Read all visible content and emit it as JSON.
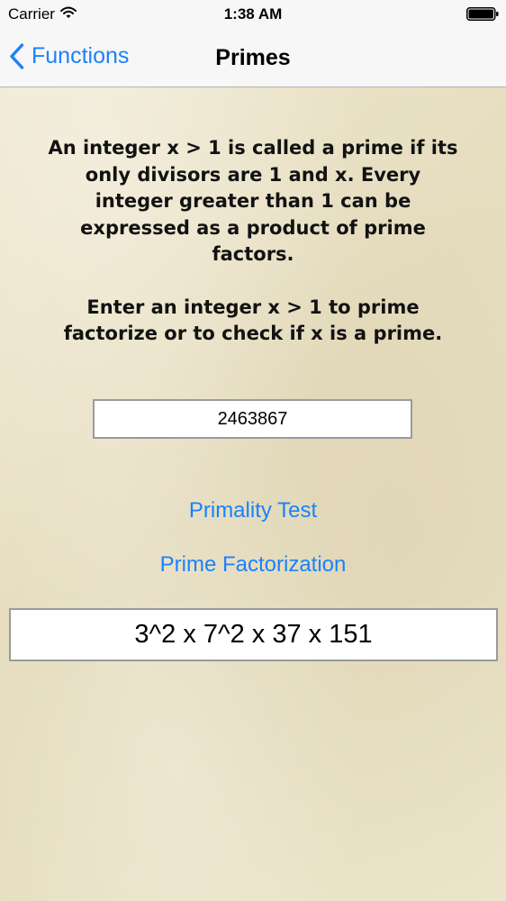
{
  "status_bar": {
    "carrier": "Carrier",
    "time": "1:38 AM",
    "wifi_icon": "wifi-icon",
    "battery_icon": "battery-icon"
  },
  "nav": {
    "back_label": "Functions",
    "back_icon": "chevron-left-icon",
    "title": "Primes"
  },
  "description": {
    "paragraph1": "An integer x > 1 is called a prime if its only divisors are 1 and x. Every integer greater than 1 can be expressed as a product of prime factors.",
    "paragraph2": "Enter an integer x > 1 to prime factorize or to check if x is a prime."
  },
  "input": {
    "value": "2463867"
  },
  "buttons": {
    "primality_test": "Primality Test",
    "prime_factorization": "Prime Factorization"
  },
  "result": {
    "text": "3^2 x 7^2 x 37 x 151"
  },
  "colors": {
    "accent": "#1a82fb",
    "background": "#ebe3c8",
    "bar": "#f7f7f7"
  }
}
